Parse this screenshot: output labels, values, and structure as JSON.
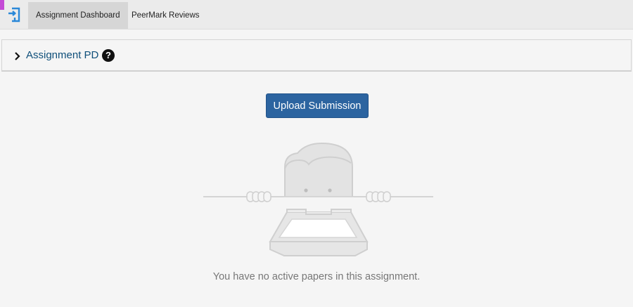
{
  "app": {
    "accent_color": "#c44bd6",
    "logo_icon": "turnitin-logo-icon"
  },
  "nav": {
    "tabs": [
      {
        "label": "Assignment Dashboard",
        "active": true
      },
      {
        "label": "PeerMark Reviews",
        "active": false
      }
    ]
  },
  "assignment": {
    "title": "Assignment PD",
    "help_icon": "question-mark",
    "expand_icon": "chevron-right-icon"
  },
  "actions": {
    "upload_label": "Upload Submission",
    "upload_color": "#2c64a0"
  },
  "empty_state": {
    "message": "You have no active papers in this assignment."
  }
}
